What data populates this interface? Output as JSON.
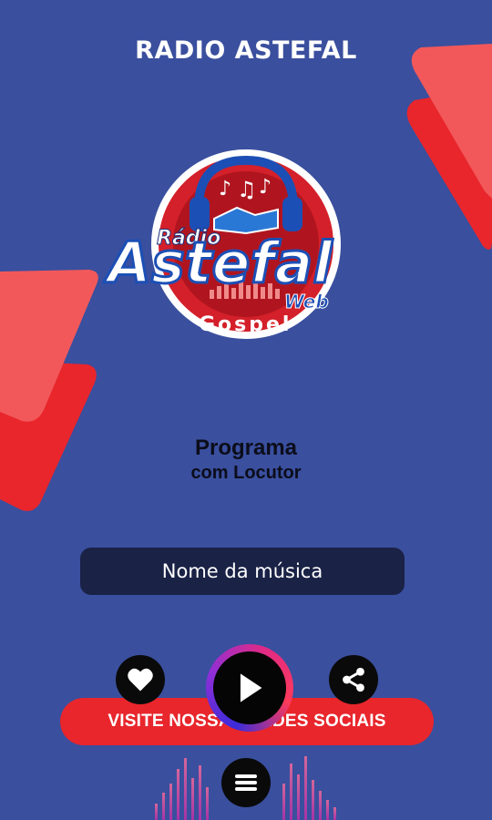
{
  "header": {
    "title": "RADIO ASTEFAL"
  },
  "logo": {
    "top_text": "Rádio",
    "main_text": "Astefal",
    "web_text": "Web",
    "bottom_text": "Gospel"
  },
  "program": {
    "title": "Programa",
    "subtitle": "com Locutor"
  },
  "now_playing": {
    "song_label": "Nome da música"
  },
  "social": {
    "button_label": "VISITE NOSSAS REDES SOCIAIS"
  },
  "controls": {
    "favorite_icon": "heart-icon",
    "play_icon": "play-icon",
    "share_icon": "share-icon",
    "menu_icon": "menu-icon"
  },
  "colors": {
    "background": "#3a4f9e",
    "accent": "#e8262c",
    "song_bar": "#1a2246"
  }
}
